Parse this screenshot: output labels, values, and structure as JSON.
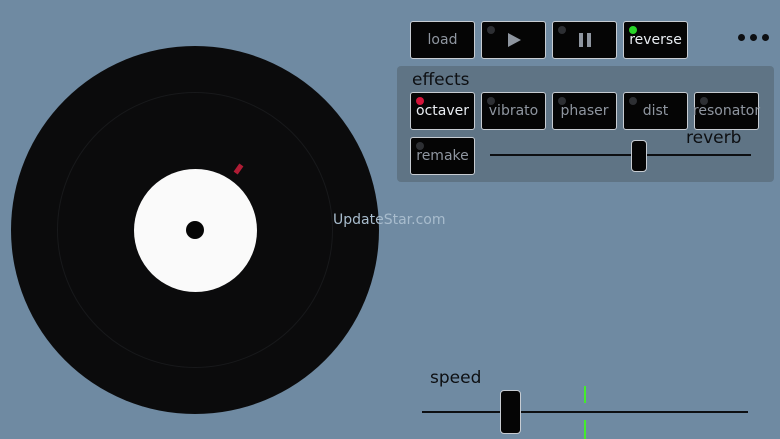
{
  "toolbar": {
    "load_label": "load",
    "play_icon": "play-icon",
    "pause_icon": "pause-icon",
    "reverse_label": "reverse",
    "reverse_active": true
  },
  "effects": {
    "title": "effects",
    "buttons": [
      {
        "label": "octaver",
        "active": true
      },
      {
        "label": "vibrato",
        "active": false
      },
      {
        "label": "phaser",
        "active": false
      },
      {
        "label": "dist",
        "active": false
      },
      {
        "label": "resonator",
        "active": false
      },
      {
        "label": "remake",
        "active": false
      }
    ],
    "reverb_label": "reverb",
    "reverb_value": 0.57
  },
  "speed": {
    "label": "speed",
    "value": 0.27,
    "marker_value": 0.5
  },
  "watermark": "UpdateStar.com",
  "colors": {
    "background": "#6f8aa2",
    "panel": "#5f7485",
    "active_green": "#28d428",
    "active_red": "#d4143a",
    "speed_marker": "#44ec2a",
    "record_marker": "#b01c35"
  }
}
